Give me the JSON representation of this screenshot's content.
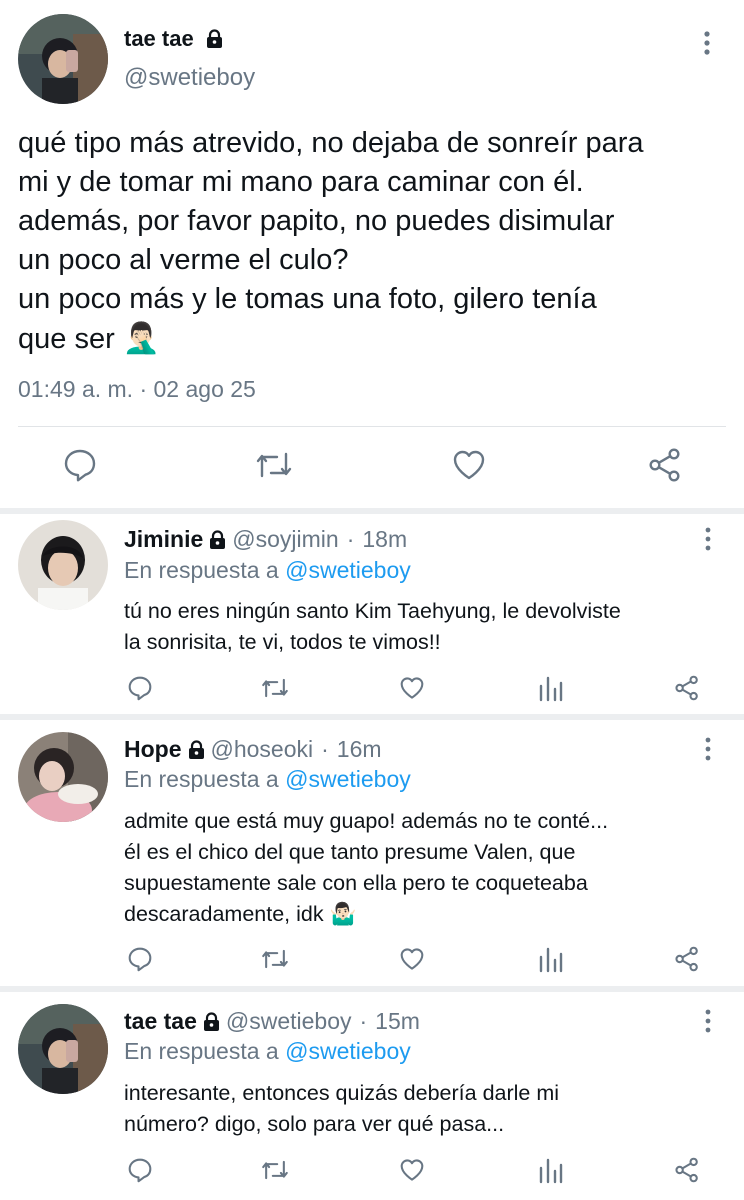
{
  "main_tweet": {
    "display_name": "tae tae",
    "handle": "@swetieboy",
    "text": "qué tipo más atrevido, no dejaba de sonreír para\nmi y de tomar mi mano para caminar con él.\nademás, por favor papito, no puedes disimular\nun poco al verme el culo?\nun poco más y le tomas una foto, gilero tenía\nque ser ",
    "emoji": "🤦🏻‍♂️",
    "timestamp": "01:49 a. m. · 02 ago 25",
    "actions": [
      "reply-icon",
      "retweet-icon",
      "like-icon",
      "share-icon"
    ]
  },
  "replies": [
    {
      "display_name": "Jiminie",
      "handle": "@soyjimin",
      "separator": "·",
      "time": "18m",
      "replying_prefix": "En respuesta a",
      "replying_to": "@swetieboy",
      "text": "tú no eres ningún santo Kim Taehyung, le devolviste\nla sonrisita, te vi, todos te vimos!!",
      "emoji": ""
    },
    {
      "display_name": "Hope",
      "handle": "@hoseoki",
      "separator": "·",
      "time": "16m",
      "replying_prefix": "En respuesta a",
      "replying_to": "@swetieboy",
      "text": "admite que está muy guapo! además no te conté...\nél es el chico del que tanto presume Valen, que\nsupuestamente sale con ella pero te coqueteaba\ndescaradamente, idk ",
      "emoji": "🤷🏻‍♂️"
    },
    {
      "display_name": "tae tae",
      "handle": "@swetieboy",
      "separator": "·",
      "time": "15m",
      "replying_prefix": "En respuesta a",
      "replying_to": "@swetieboy",
      "text": "interesante, entonces quizás debería darle mi\nnúmero? digo, solo para ver qué pasa...",
      "emoji": ""
    }
  ],
  "colors": {
    "text": "#0f1419",
    "secondary": "#687684",
    "link": "#1d9bf0",
    "divider": "#eceef0"
  },
  "icons": [
    "lock-icon",
    "more-options-icon",
    "reply-icon",
    "retweet-icon",
    "like-icon",
    "views-icon",
    "share-icon"
  ]
}
